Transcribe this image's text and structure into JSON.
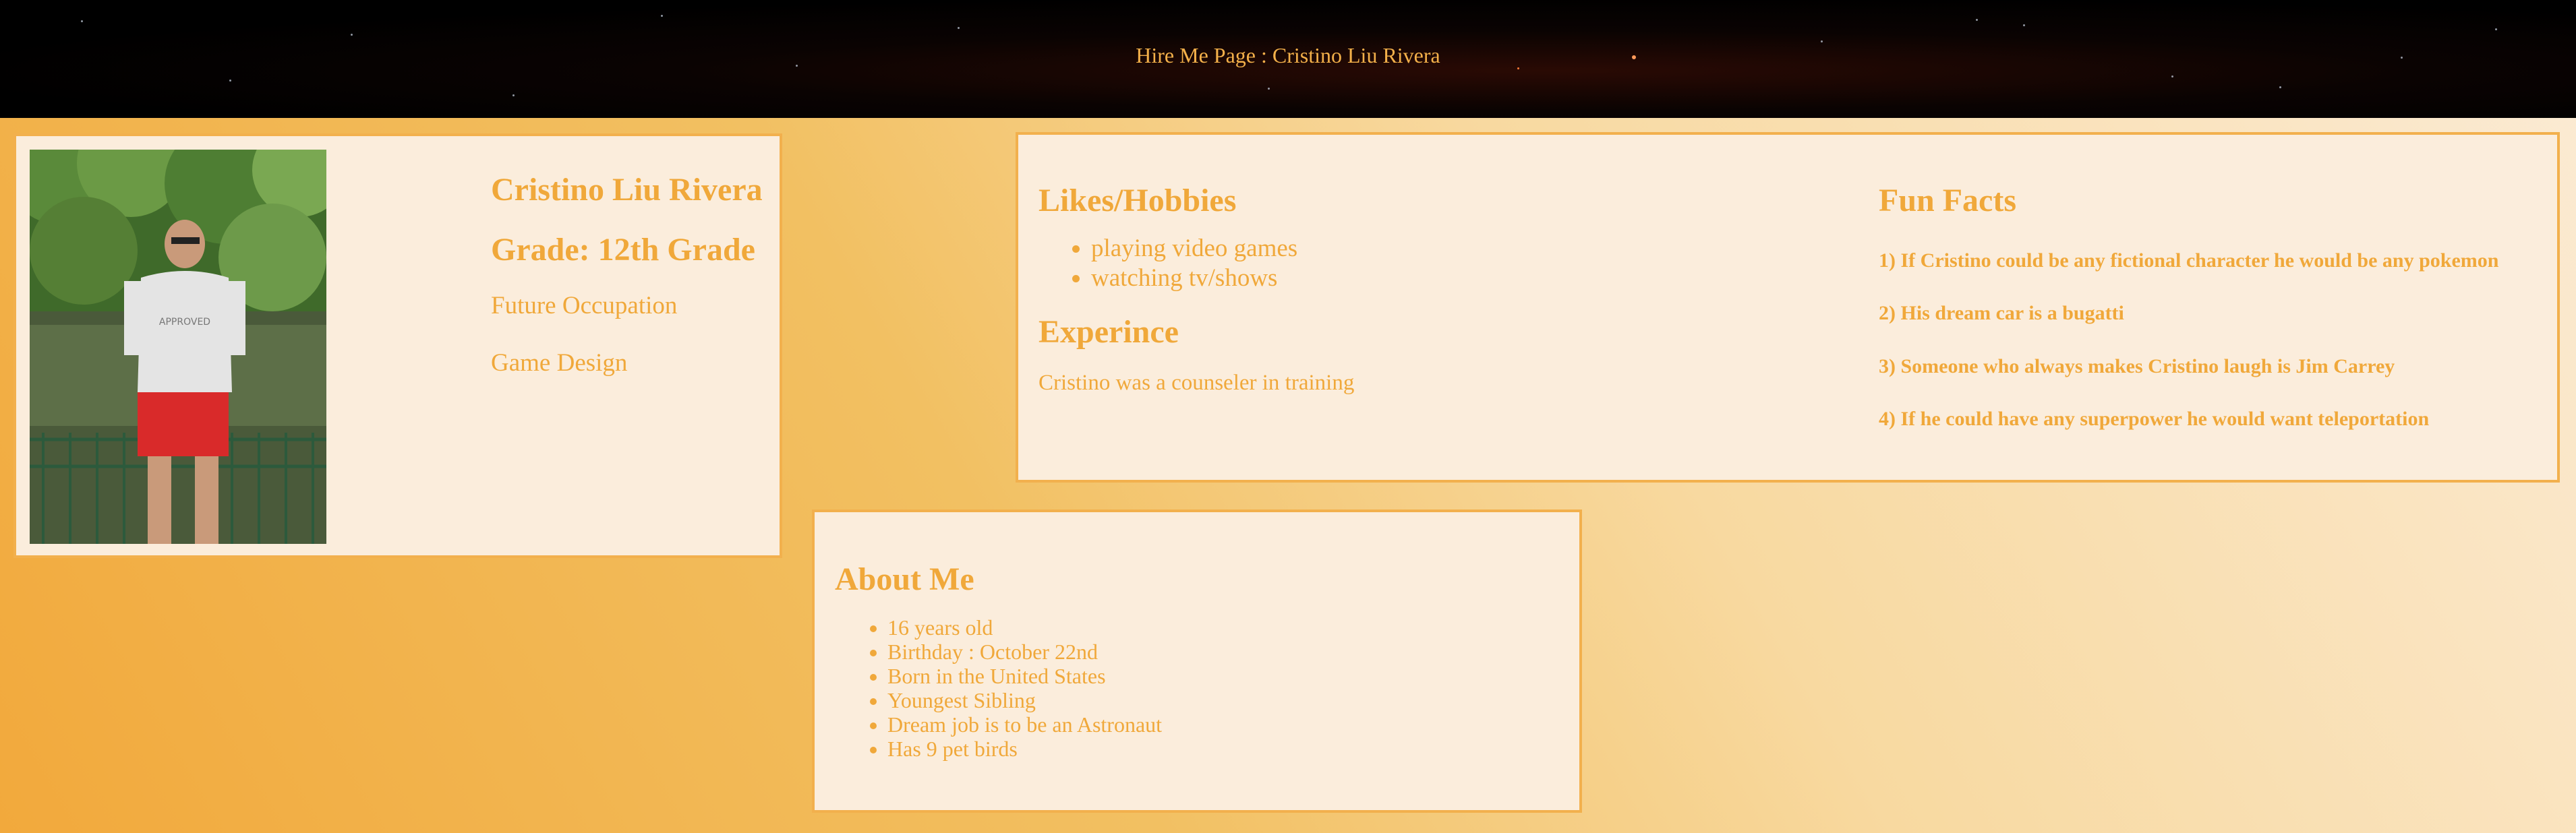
{
  "header": {
    "title": "Hire Me Page : Cristino Liu Rivera"
  },
  "profile": {
    "photo_icon": "person-photo",
    "name": "Cristino Liu Rivera",
    "grade": "Grade: 12th Grade",
    "occupation_label": "Future Occupation",
    "occupation_value": "Game Design"
  },
  "likes": {
    "heading": "Likes/Hobbies",
    "items": [
      "playing video games",
      "watching tv/shows"
    ]
  },
  "experience": {
    "heading": "Experince",
    "text": "Cristino was a counseler in training"
  },
  "fun_facts": {
    "heading": "Fun Facts",
    "items": [
      "1) If Cristino could be any fictional character he would be any pokemon",
      "2) His dream car is a bugatti",
      "3) Someone who always makes Cristino laugh is Jim Carrey",
      "4) If he could have any superpower he would want teleportation"
    ]
  },
  "about": {
    "heading": "About Me",
    "items": [
      "16 years old",
      "Birthday : October 22nd",
      "Born in the United States",
      "Youngest Sibling",
      "Dream job is to be an Astronaut",
      "Has 9 pet birds"
    ]
  },
  "colors": {
    "accent": "#f0a83a",
    "panel_bg": "#fbeddc",
    "border": "#f2b04d",
    "header_bg": "#000000"
  }
}
